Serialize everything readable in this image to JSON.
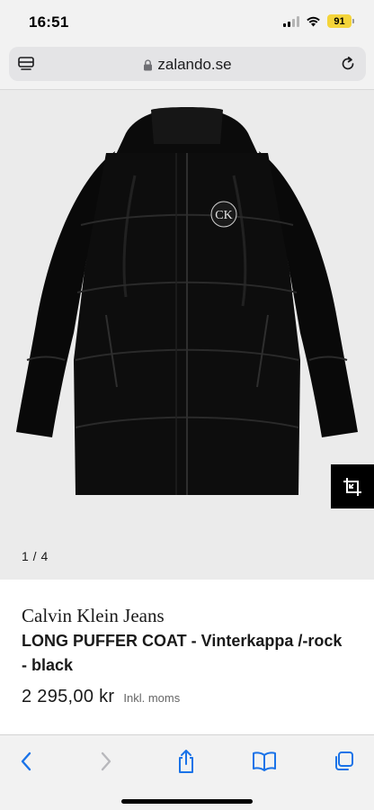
{
  "status_bar": {
    "time": "16:51",
    "battery_level": "91",
    "battery_color": "#f4d43a",
    "icons": [
      "cellular-signal-icon",
      "wifi-icon",
      "battery-icon"
    ]
  },
  "browser": {
    "url": "zalando.se",
    "icons": [
      "reader-mode-icon",
      "lock-icon",
      "reload-icon"
    ]
  },
  "gallery": {
    "counter": "1 / 4",
    "product_image_logo_text": "CK",
    "compare_icon": "crop-compare-icon",
    "background_color": "#ebebeb"
  },
  "product": {
    "brand": "Calvin Klein Jeans",
    "title": "LONG PUFFER COAT - Vinterkappa /-rock - black",
    "price": "2 295,00 kr",
    "price_note": "Inkl. moms"
  },
  "toolbar": {
    "icons": [
      "back-icon",
      "forward-icon",
      "share-icon",
      "bookmarks-icon",
      "tabs-icon"
    ],
    "accent_color": "#1a73e8"
  }
}
